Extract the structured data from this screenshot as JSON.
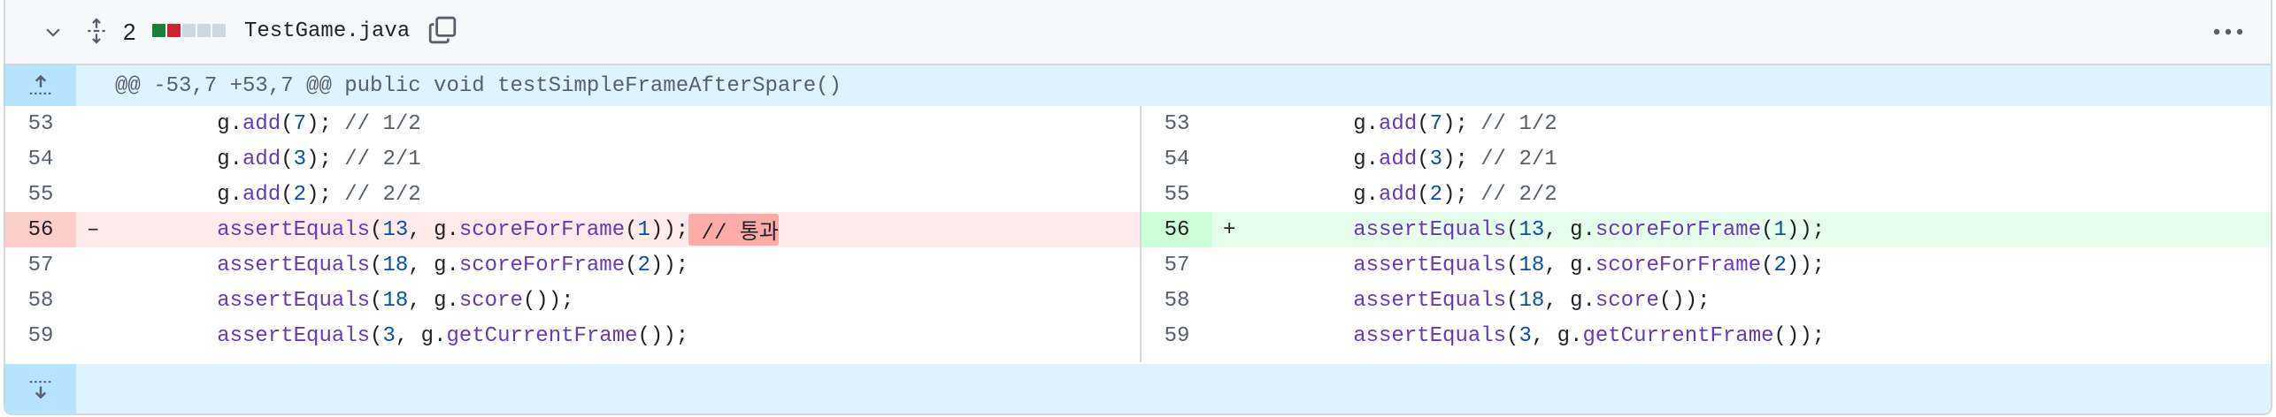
{
  "file": {
    "name": "TestGame.java",
    "changes": "2",
    "diffstat_colors": [
      "#1a7f37",
      "#cf222e",
      "#d0d7de",
      "#d0d7de",
      "#d0d7de"
    ]
  },
  "icons": {
    "collapse": "chevron-down-icon",
    "expand_all": "unfold-icon",
    "copy": "copy-icon",
    "more": "kebab-horizontal-icon",
    "expand_up": "expand-up-icon",
    "expand_down": "expand-down-icon"
  },
  "hunk": {
    "header": "@@ -53,7 +53,7 @@ public void testSimpleFrameAfterSpare()"
  },
  "left": {
    "rows": [
      {
        "num": "53",
        "type": "ctx",
        "marker": "",
        "tokens": [
          [
            "",
            "        g."
          ],
          [
            "m",
            "add"
          ],
          [
            "",
            "("
          ],
          [
            "n",
            "7"
          ],
          [
            "",
            "); "
          ],
          [
            "c",
            "// 1/2"
          ]
        ]
      },
      {
        "num": "54",
        "type": "ctx",
        "marker": "",
        "tokens": [
          [
            "",
            "        g."
          ],
          [
            "m",
            "add"
          ],
          [
            "",
            "("
          ],
          [
            "n",
            "3"
          ],
          [
            "",
            "); "
          ],
          [
            "c",
            "// 2/1"
          ]
        ]
      },
      {
        "num": "55",
        "type": "ctx",
        "marker": "",
        "tokens": [
          [
            "",
            "        g."
          ],
          [
            "m",
            "add"
          ],
          [
            "",
            "("
          ],
          [
            "n",
            "2"
          ],
          [
            "",
            "); "
          ],
          [
            "c",
            "// 2/2"
          ]
        ]
      },
      {
        "num": "56",
        "type": "del",
        "marker": "–",
        "tokens": [
          [
            "",
            "        "
          ],
          [
            "m",
            "assertEquals"
          ],
          [
            "",
            "("
          ],
          [
            "n",
            "13"
          ],
          [
            "",
            ", g."
          ],
          [
            "m",
            "scoreForFrame"
          ],
          [
            "",
            "("
          ],
          [
            "n",
            "1"
          ],
          [
            "",
            "));"
          ],
          [
            "hl",
            " // 통과"
          ]
        ]
      },
      {
        "num": "57",
        "type": "ctx",
        "marker": "",
        "tokens": [
          [
            "",
            "        "
          ],
          [
            "m",
            "assertEquals"
          ],
          [
            "",
            "("
          ],
          [
            "n",
            "18"
          ],
          [
            "",
            ", g."
          ],
          [
            "m",
            "scoreForFrame"
          ],
          [
            "",
            "("
          ],
          [
            "n",
            "2"
          ],
          [
            "",
            "));"
          ]
        ]
      },
      {
        "num": "58",
        "type": "ctx",
        "marker": "",
        "tokens": [
          [
            "",
            "        "
          ],
          [
            "m",
            "assertEquals"
          ],
          [
            "",
            "("
          ],
          [
            "n",
            "18"
          ],
          [
            "",
            ", g."
          ],
          [
            "m",
            "score"
          ],
          [
            "",
            "());"
          ]
        ]
      },
      {
        "num": "59",
        "type": "ctx",
        "marker": "",
        "tokens": [
          [
            "",
            "        "
          ],
          [
            "m",
            "assertEquals"
          ],
          [
            "",
            "("
          ],
          [
            "n",
            "3"
          ],
          [
            "",
            ", g."
          ],
          [
            "m",
            "getCurrentFrame"
          ],
          [
            "",
            "());"
          ]
        ]
      }
    ]
  },
  "right": {
    "rows": [
      {
        "num": "53",
        "type": "ctx",
        "marker": "",
        "tokens": [
          [
            "",
            "        g."
          ],
          [
            "m",
            "add"
          ],
          [
            "",
            "("
          ],
          [
            "n",
            "7"
          ],
          [
            "",
            "); "
          ],
          [
            "c",
            "// 1/2"
          ]
        ]
      },
      {
        "num": "54",
        "type": "ctx",
        "marker": "",
        "tokens": [
          [
            "",
            "        g."
          ],
          [
            "m",
            "add"
          ],
          [
            "",
            "("
          ],
          [
            "n",
            "3"
          ],
          [
            "",
            "); "
          ],
          [
            "c",
            "// 2/1"
          ]
        ]
      },
      {
        "num": "55",
        "type": "ctx",
        "marker": "",
        "tokens": [
          [
            "",
            "        g."
          ],
          [
            "m",
            "add"
          ],
          [
            "",
            "("
          ],
          [
            "n",
            "2"
          ],
          [
            "",
            "); "
          ],
          [
            "c",
            "// 2/2"
          ]
        ]
      },
      {
        "num": "56",
        "type": "add",
        "marker": "+",
        "tokens": [
          [
            "",
            "        "
          ],
          [
            "m",
            "assertEquals"
          ],
          [
            "",
            "("
          ],
          [
            "n",
            "13"
          ],
          [
            "",
            ", g."
          ],
          [
            "m",
            "scoreForFrame"
          ],
          [
            "",
            "("
          ],
          [
            "n",
            "1"
          ],
          [
            "",
            "));"
          ]
        ]
      },
      {
        "num": "57",
        "type": "ctx",
        "marker": "",
        "tokens": [
          [
            "",
            "        "
          ],
          [
            "m",
            "assertEquals"
          ],
          [
            "",
            "("
          ],
          [
            "n",
            "18"
          ],
          [
            "",
            ", g."
          ],
          [
            "m",
            "scoreForFrame"
          ],
          [
            "",
            "("
          ],
          [
            "n",
            "2"
          ],
          [
            "",
            "));"
          ]
        ]
      },
      {
        "num": "58",
        "type": "ctx",
        "marker": "",
        "tokens": [
          [
            "",
            "        "
          ],
          [
            "m",
            "assertEquals"
          ],
          [
            "",
            "("
          ],
          [
            "n",
            "18"
          ],
          [
            "",
            ", g."
          ],
          [
            "m",
            "score"
          ],
          [
            "",
            "());"
          ]
        ]
      },
      {
        "num": "59",
        "type": "ctx",
        "marker": "",
        "tokens": [
          [
            "",
            "        "
          ],
          [
            "m",
            "assertEquals"
          ],
          [
            "",
            "("
          ],
          [
            "n",
            "3"
          ],
          [
            "",
            ", g."
          ],
          [
            "m",
            "getCurrentFrame"
          ],
          [
            "",
            "());"
          ]
        ]
      }
    ]
  }
}
